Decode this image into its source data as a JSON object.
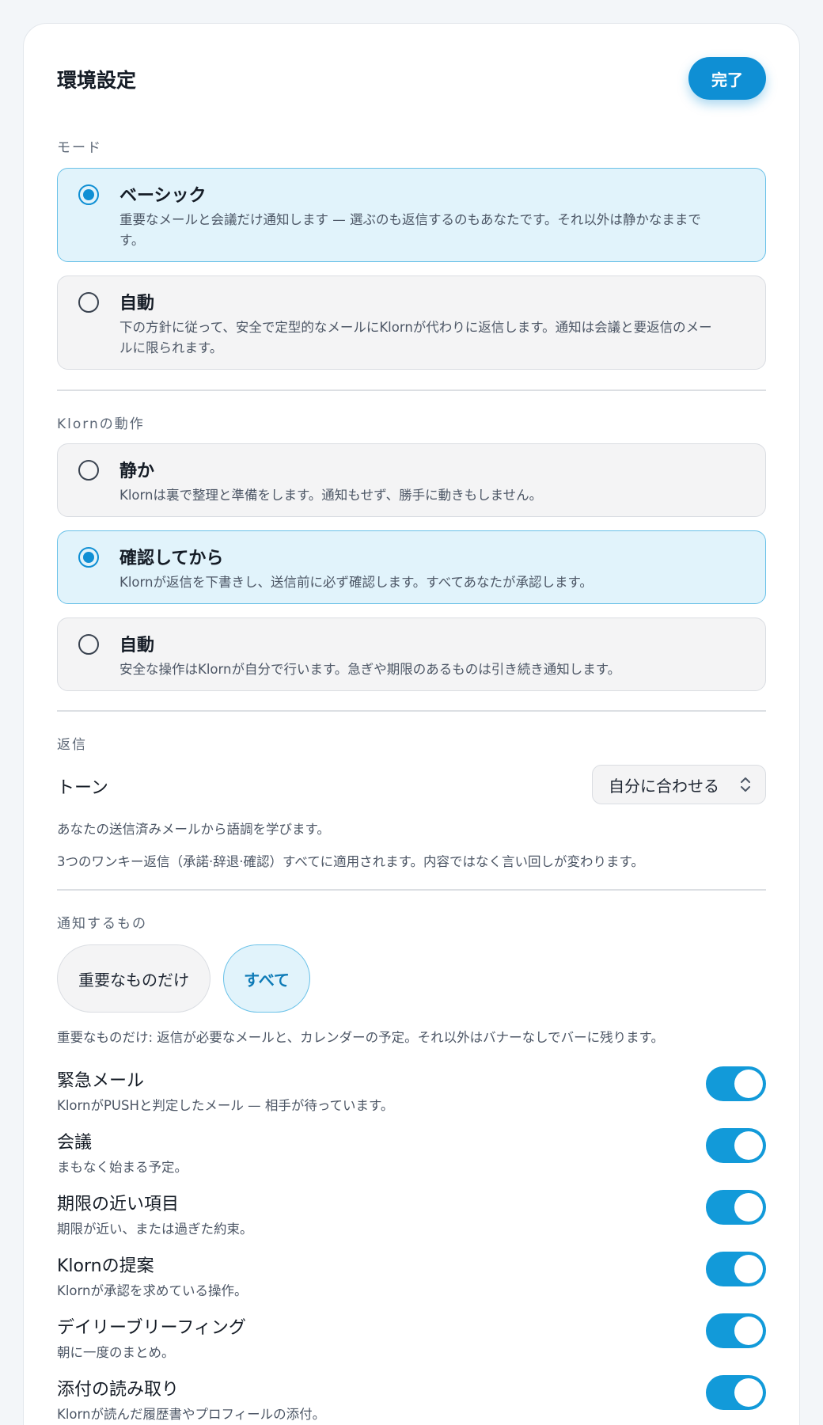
{
  "header": {
    "title": "環境設定",
    "done_label": "完了"
  },
  "mode": {
    "label": "モード",
    "options": [
      {
        "title": "ベーシック",
        "desc": "重要なメールと会議だけ通知します — 選ぶのも返信するのもあなたです。それ以外は静かなままです。",
        "selected": true
      },
      {
        "title": "自動",
        "desc": "下の方針に従って、安全で定型的なメールにKlornが代わりに返信します。通知は会議と要返信のメールに限られます。",
        "selected": false
      }
    ]
  },
  "behavior": {
    "label": "Klornの動作",
    "options": [
      {
        "title": "静か",
        "desc": "Klornは裏で整理と準備をします。通知もせず、勝手に動きもしません。",
        "selected": false
      },
      {
        "title": "確認してから",
        "desc": "Klornが返信を下書きし、送信前に必ず確認します。すべてあなたが承認します。",
        "selected": true
      },
      {
        "title": "自動",
        "desc": "安全な操作はKlornが自分で行います。急ぎや期限のあるものは引き続き通知します。",
        "selected": false
      }
    ]
  },
  "reply": {
    "label": "返信",
    "tone_label": "トーン",
    "tone_value": "自分に合わせる",
    "note1": "あなたの送信済みメールから語調を学びます。",
    "note2": "3つのワンキー返信（承諾·辞退·確認）すべてに適用されます。内容ではなく言い回しが変わります。"
  },
  "notify": {
    "label": "通知するもの",
    "pill_important": "重要なものだけ",
    "pill_all": "すべて",
    "selected": "すべて",
    "note": "重要なものだけ: 返信が必要なメールと、カレンダーの予定。それ以外はバナーなしでバーに残ります。",
    "items": [
      {
        "title": "緊急メール",
        "desc": "KlornがPUSHと判定したメール — 相手が待っています。",
        "on": true
      },
      {
        "title": "会議",
        "desc": "まもなく始まる予定。",
        "on": true
      },
      {
        "title": "期限の近い項目",
        "desc": "期限が近い、または過ぎた約束。",
        "on": true
      },
      {
        "title": "Klornの提案",
        "desc": "Klornが承認を求めている操作。",
        "on": true
      },
      {
        "title": "デイリーブリーフィング",
        "desc": "朝に一度のまとめ。",
        "on": true
      },
      {
        "title": "添付の読み取り",
        "desc": "Klornが読んだ履歴書やプロフィールの添付。",
        "on": true
      }
    ]
  },
  "colors": {
    "accent": "#0f8fd4",
    "selected_bg": "#e1f3fb",
    "selected_border": "#69c1e8"
  }
}
